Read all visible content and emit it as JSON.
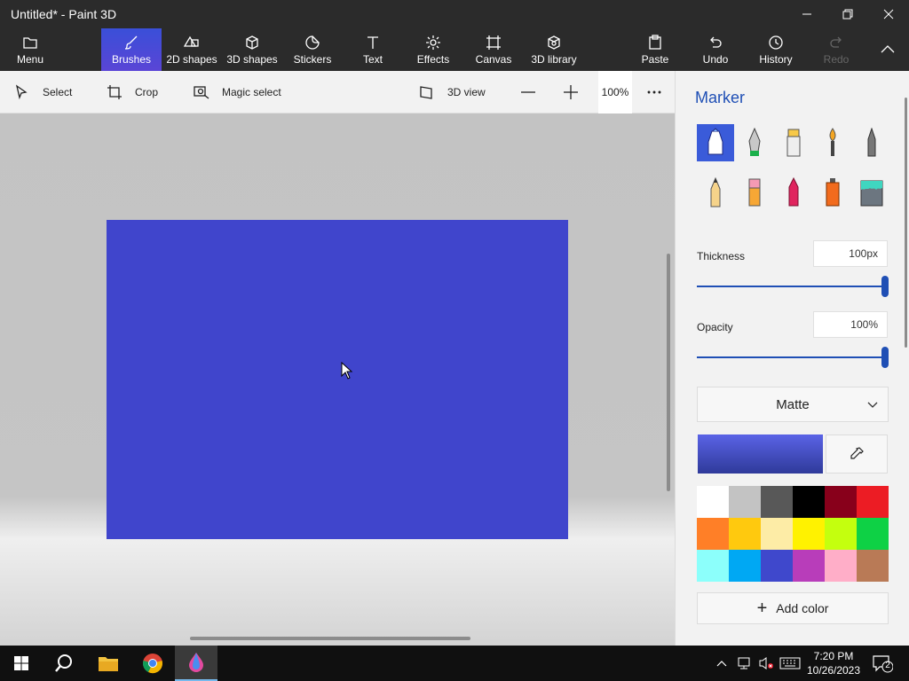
{
  "window": {
    "title": "Untitled* - Paint 3D"
  },
  "ribbon": {
    "menu": "Menu",
    "items": [
      {
        "label": "Brushes",
        "icon": "brush-icon",
        "active": true
      },
      {
        "label": "2D shapes",
        "icon": "shapes-2d-icon"
      },
      {
        "label": "3D shapes",
        "icon": "cube-icon"
      },
      {
        "label": "Stickers",
        "icon": "sticker-icon"
      },
      {
        "label": "Text",
        "icon": "text-icon"
      },
      {
        "label": "Effects",
        "icon": "sun-icon"
      },
      {
        "label": "Canvas",
        "icon": "canvas-icon"
      },
      {
        "label": "3D library",
        "icon": "library-icon"
      }
    ],
    "paste": "Paste",
    "undo": "Undo",
    "history": "History",
    "redo": "Redo"
  },
  "toolbar": {
    "select": "Select",
    "crop": "Crop",
    "magic_select": "Magic select",
    "view_3d": "3D view",
    "zoom": "100%"
  },
  "panel": {
    "title": "Marker",
    "thickness_label": "Thickness",
    "thickness_value": "100px",
    "thickness_level": 1.0,
    "opacity_label": "Opacity",
    "opacity_value": "100%",
    "opacity_level": 1.0,
    "finish": "Matte",
    "add_color": "Add color",
    "brushes": [
      "marker",
      "calligraphy-pen",
      "oil-brush",
      "watercolor",
      "pixel-pen",
      "pencil",
      "eraser",
      "crayon",
      "spray-can",
      "fill"
    ],
    "selected_brush": "marker",
    "selected_color": "#4045cc",
    "palette": [
      "#ffffff",
      "#c3c3c3",
      "#585858",
      "#000000",
      "#88001b",
      "#ec1c24",
      "#ff7f27",
      "#ffc90e",
      "#fdeca6",
      "#fff200",
      "#c4ff0e",
      "#0ed145",
      "#8cfffb",
      "#00a8f3",
      "#3f48cc",
      "#b83dba",
      "#ffaec8",
      "#b97a56"
    ]
  },
  "canvas": {
    "fill_color": "#4045cc"
  },
  "taskbar": {
    "time": "7:20 PM",
    "date": "10/26/2023",
    "notifications": "2"
  }
}
